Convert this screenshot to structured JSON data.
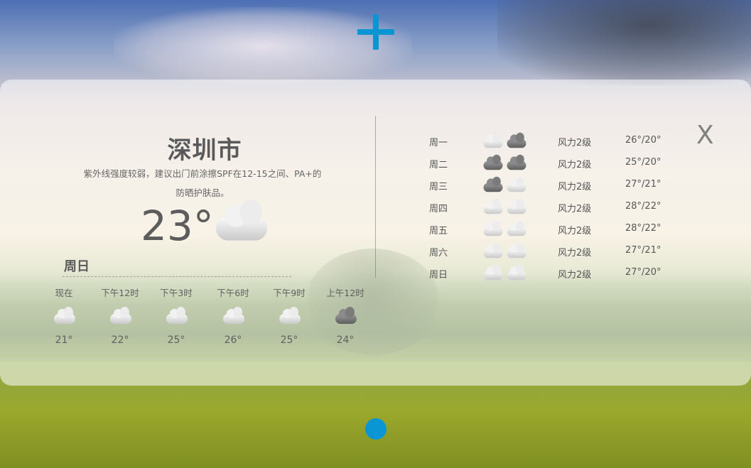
{
  "header": {
    "add_icon": "plus-icon",
    "accent_color": "#0a96d2"
  },
  "current": {
    "city": "深圳市",
    "advice": "紫外线强度较弱，建议出门前涂擦SPF在12-15之间、PA+的防晒护肤品。",
    "temperature": "23°",
    "condition_icon": "cloudy-icon"
  },
  "hourly": {
    "day": "周日",
    "items": [
      {
        "time": "现在",
        "temp": "21°",
        "icon": "cloudy-icon"
      },
      {
        "time": "下午12时",
        "temp": "22°",
        "icon": "cloudy-icon"
      },
      {
        "time": "下午3时",
        "temp": "25°",
        "icon": "cloudy-icon"
      },
      {
        "time": "下午6时",
        "temp": "26°",
        "icon": "cloudy-icon"
      },
      {
        "time": "下午9时",
        "temp": "25°",
        "icon": "cloudy-icon"
      },
      {
        "time": "上午12时",
        "temp": "24°",
        "icon": "overcast-icon"
      }
    ]
  },
  "forecast": [
    {
      "day": "周一",
      "wind": "风力2级",
      "range": "26°/20°",
      "icons": [
        "cloudy-icon",
        "rain-icon"
      ]
    },
    {
      "day": "周二",
      "wind": "风力2级",
      "range": "25°/20°",
      "icons": [
        "rain-icon",
        "rain-icon"
      ]
    },
    {
      "day": "周三",
      "wind": "风力2级",
      "range": "27°/21°",
      "icons": [
        "rain-icon",
        "cloudy-icon"
      ]
    },
    {
      "day": "周四",
      "wind": "风力2级",
      "range": "28°/22°",
      "icons": [
        "cloudy-icon",
        "cloudy-icon"
      ]
    },
    {
      "day": "周五",
      "wind": "风力2级",
      "range": "28°/22°",
      "icons": [
        "cloudy-icon",
        "cloudy-icon"
      ]
    },
    {
      "day": "周六",
      "wind": "风力2级",
      "range": "27°/21°",
      "icons": [
        "cloudy-icon",
        "cloudy-icon"
      ]
    },
    {
      "day": "周日",
      "wind": "风力2级",
      "range": "27°/20°",
      "icons": [
        "cloudy-icon",
        "cloudy-icon"
      ]
    }
  ],
  "close_label": "X",
  "pagination": {
    "current_page": 1,
    "total_pages": 1
  }
}
